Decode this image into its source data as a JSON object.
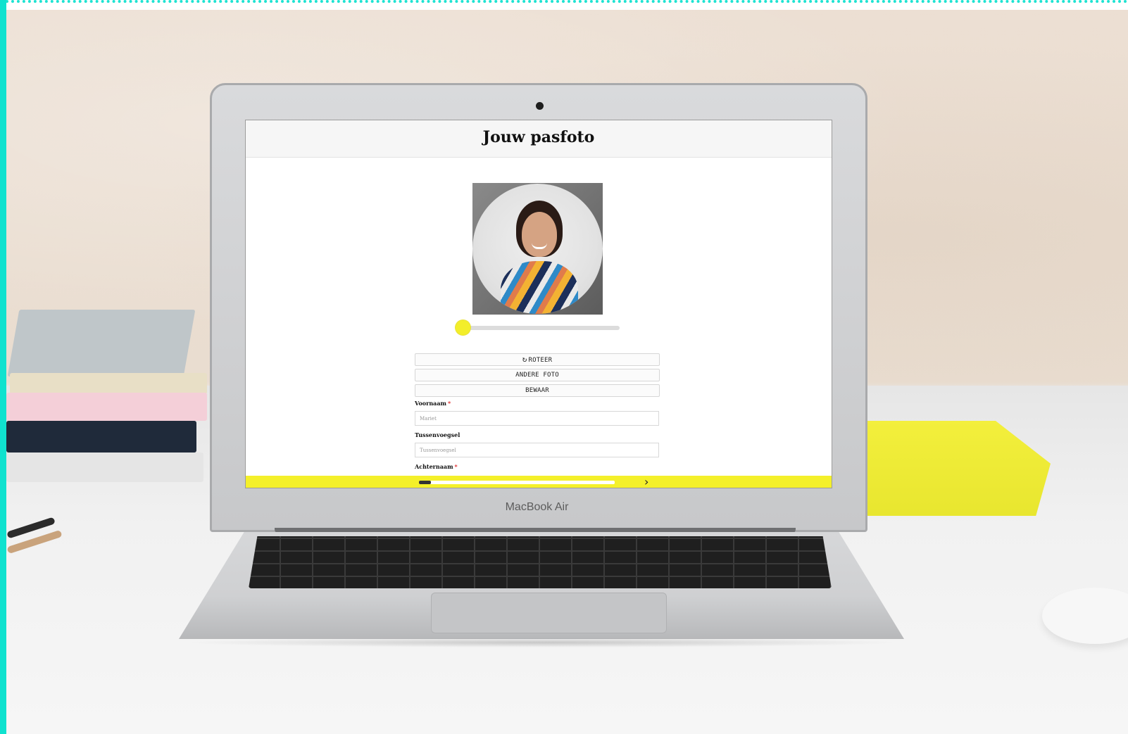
{
  "page": {
    "title": "Jouw pasfoto"
  },
  "photo": {
    "slider_value": 0
  },
  "buttons": {
    "rotate_label": "ROTEER",
    "other_photo_label": "ANDERE FOTO",
    "save_label": "BEWAAR"
  },
  "form": {
    "first_name": {
      "label": "Voornaam",
      "required_mark": "*",
      "value": "Mariet"
    },
    "middle_name": {
      "label": "Tussenvoegsel",
      "placeholder": "Tussenvoegsel"
    },
    "last_name": {
      "label": "Achternaam",
      "required_mark": "*"
    }
  },
  "footer": {
    "progress_fraction": 0.06,
    "next_symbol": "›"
  },
  "device": {
    "brand_label": "MacBook Air"
  },
  "colors": {
    "accent_yellow": "#f4f02a",
    "frame_cyan": "#10e2cf",
    "required_red": "#e03030"
  },
  "icons": {
    "rotate": "rotate-icon",
    "next": "chevron-right-icon"
  }
}
